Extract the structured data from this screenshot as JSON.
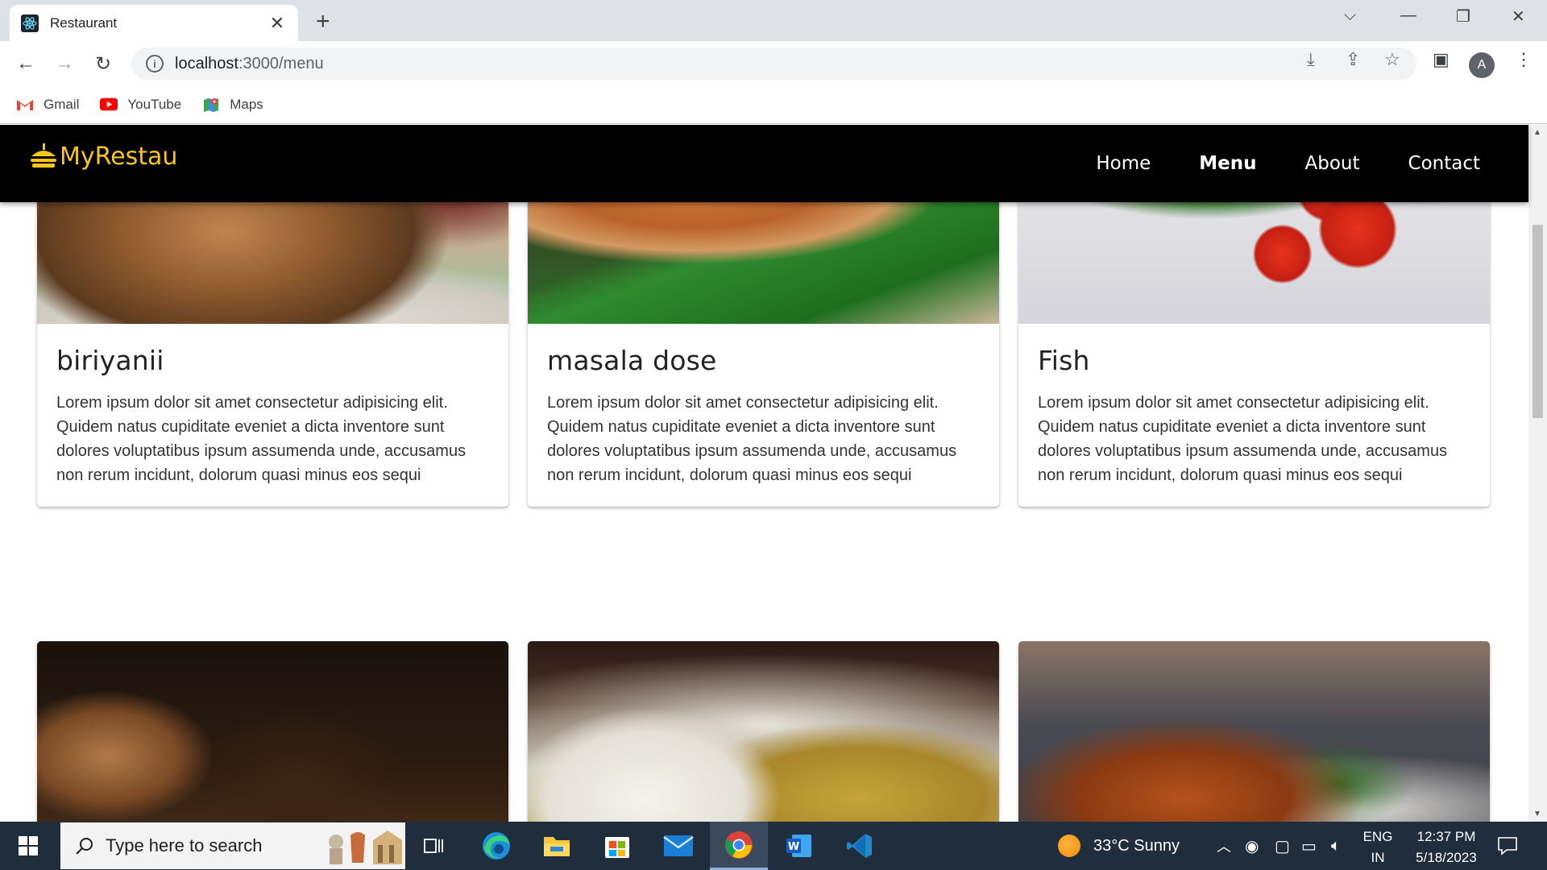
{
  "browser": {
    "tab_title": "Restaurant",
    "url_host": "localhost",
    "url_path": ":3000/menu",
    "profile_initial": "A",
    "bookmarks": [
      {
        "label": "Gmail",
        "icon": "gmail-icon"
      },
      {
        "label": "YouTube",
        "icon": "youtube-icon"
      },
      {
        "label": "Maps",
        "icon": "maps-icon"
      }
    ]
  },
  "site": {
    "logo_text": "MyRestau",
    "nav": [
      {
        "label": "Home",
        "active": false
      },
      {
        "label": "Menu",
        "active": true
      },
      {
        "label": "About",
        "active": false
      },
      {
        "label": "Contact",
        "active": false
      }
    ]
  },
  "menu": {
    "items": [
      {
        "name": "biriyanii",
        "description": "Lorem ipsum dolor sit amet consectetur adipisicing elit. Quidem natus cupiditate eveniet a dicta inventore sunt dolores voluptatibus ipsum assumenda unde, accusamus non rerum incidunt, dolorum quasi minus eos sequi"
      },
      {
        "name": "masala dose",
        "description": "Lorem ipsum dolor sit amet consectetur adipisicing elit. Quidem natus cupiditate eveniet a dicta inventore sunt dolores voluptatibus ipsum assumenda unde, accusamus non rerum incidunt, dolorum quasi minus eos sequi"
      },
      {
        "name": "Fish",
        "description": "Lorem ipsum dolor sit amet consectetur adipisicing elit. Quidem natus cupiditate eveniet a dicta inventore sunt dolores voluptatibus ipsum assumenda unde, accusamus non rerum incidunt, dolorum quasi minus eos sequi"
      }
    ]
  },
  "taskbar": {
    "search_placeholder": "Type here to search",
    "weather": "33°C  Sunny",
    "lang_line1": "ENG",
    "lang_line2": "IN",
    "time": "12:37 PM",
    "date": "5/18/2023"
  },
  "colors": {
    "brand": "#f7c51b",
    "nav_bg": "#000000",
    "taskbar_bg": "#1f2d3d"
  }
}
